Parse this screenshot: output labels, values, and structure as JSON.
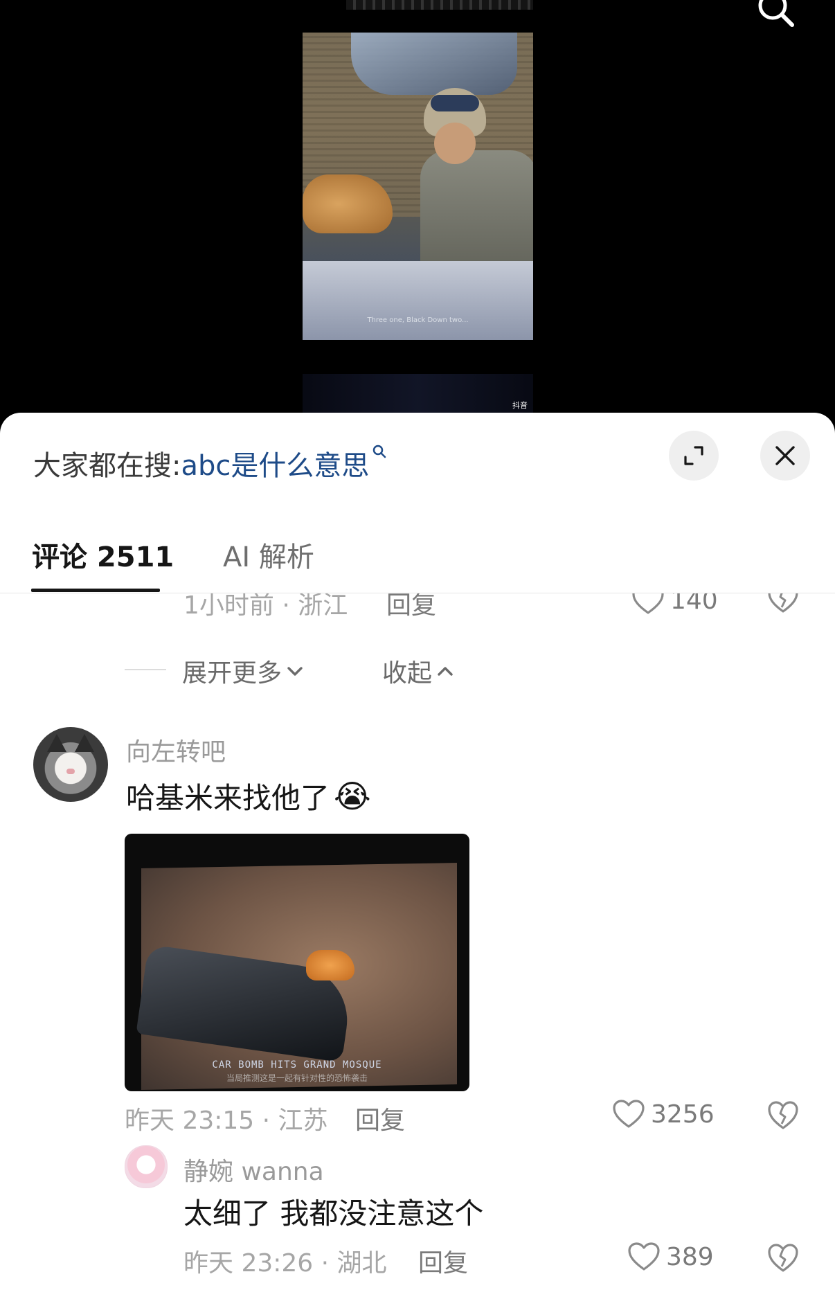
{
  "video": {
    "subtitle": "Three one, Black Down two...",
    "watermark": "抖音"
  },
  "header": {
    "hot_search_label": "大家都在搜:",
    "hot_search_query": "abc是什么意思"
  },
  "tabs": [
    {
      "label": "评论 2511",
      "active": true
    },
    {
      "label": "AI 解析",
      "active": false
    }
  ],
  "previous_comment": {
    "meta": "1小时前 · 浙江",
    "reply_label": "回复",
    "likes": "140"
  },
  "thread_controls": {
    "expand_more": "展开更多",
    "collapse": "收起"
  },
  "comments": [
    {
      "username": "向左转吧",
      "text": "哈基米来找他了",
      "emoji": "😭",
      "image_caption": "CAR BOMB HITS GRAND MOSQUE",
      "image_caption_cn": "当局推测这是一起有针对性的恐怖袭击",
      "meta": "昨天 23:15 · 江苏",
      "reply_label": "回复",
      "likes": "3256"
    }
  ],
  "replies": [
    {
      "username": "静婉 wanna",
      "text": "太细了 我都没注意这个",
      "meta": "昨天 23:26 · 湖北",
      "reply_label": "回复",
      "likes": "389"
    }
  ],
  "colors": {
    "query_link": "#1e4b88",
    "text_primary": "#161616",
    "text_secondary": "#9a9a9a",
    "sheet_bg": "#ffffff",
    "button_bg": "#efefef"
  }
}
